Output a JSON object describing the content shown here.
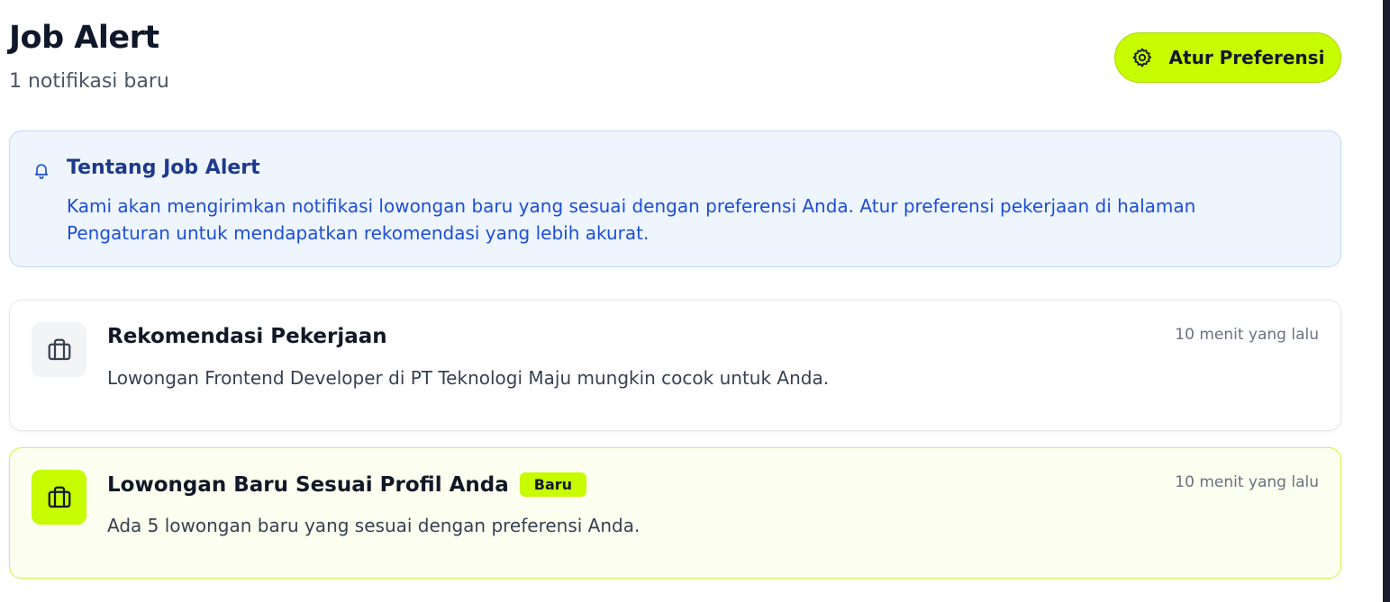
{
  "header": {
    "title": "Job Alert",
    "subtitle": "1 notifikasi baru",
    "preferences_button": {
      "label": "Atur Preferensi",
      "icon": "gear-icon"
    }
  },
  "info": {
    "icon": "bell-icon",
    "title": "Tentang Job Alert",
    "text": "Kami akan mengirimkan notifikasi lowongan baru yang sesuai dengan preferensi Anda. Atur preferensi pekerjaan di halaman Pengaturan untuk mendapatkan rekomendasi yang lebih akurat."
  },
  "notifications": [
    {
      "icon": "briefcase-icon",
      "title": "Rekomendasi Pekerjaan",
      "message": "Lowongan Frontend Developer di PT Teknologi Maju mungkin cocok untuk Anda.",
      "time": "10 menit yang lalu",
      "badge": ""
    },
    {
      "icon": "briefcase-icon",
      "title": "Lowongan Baru Sesuai Profil Anda",
      "message": "Ada 5 lowongan baru yang sesuai dengan preferensi Anda.",
      "time": "10 menit yang lalu",
      "badge": "Baru"
    }
  ],
  "colors": {
    "accent": "#c6fb00",
    "info_bg": "#eef5ff",
    "info_title": "#1e3a8a",
    "info_text": "#1d4ed8",
    "unread_bg": "#fcffef"
  }
}
